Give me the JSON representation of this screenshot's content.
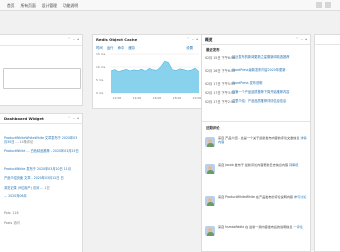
{
  "topbar": {
    "nav": [
      "首页",
      "所有页面",
      "设计管理",
      "功能说明"
    ]
  },
  "left_panel_top": {
    "ctrl": [
      "⌃",
      "⌄",
      "▴"
    ]
  },
  "dashboard_widget": {
    "title": "Dashboard Widget",
    "items": [
      {
        "text": "ProductWhiteWhiteWhite 文章发布于 2020年03月30日 …",
        "meta": "14条评论"
      },
      {
        "text": "ProductWhite … 白色精品推荐 - 2020年03月25日",
        "meta": ""
      },
      {
        "text": "ProductWhite 发布于 2020年03月20日 11月",
        "meta": ""
      },
      {
        "text": "产品介绍页面 文章 - 2020年03月12日 日",
        "meta": ""
      },
      {
        "text": "浏览记录 (9位用户) 访问 …",
        "meta": "1日"
      },
      {
        "text": "… 2020年06月",
        "meta": ""
      },
      {
        "text": "Pols: 116",
        "meta": ""
      },
      {
        "text": "Posts 访问",
        "meta": ""
      }
    ]
  },
  "chart_panel": {
    "title": "Redis Object Cache",
    "tabs": [
      "时间",
      "运行",
      "命中",
      "缓存"
    ],
    "corner_link": "设置"
  },
  "chart_data": {
    "type": "area",
    "title": "",
    "xlabel": "",
    "ylabel": "",
    "y_ticks": [
      "15 ms",
      "10 ms",
      "5 ms",
      "0 ms"
    ],
    "ylim": [
      0,
      15
    ],
    "x_ticks": [
      "12:00",
      "14:00",
      "16:00",
      "18:00",
      "20:00"
    ],
    "values": [
      8.5,
      9.0,
      8.2,
      8.7,
      9.1,
      8.5,
      8.9,
      8.6,
      9.2,
      8.4,
      9.5,
      8.9,
      8.8,
      10.1,
      12.2,
      11.8,
      9.0,
      8.6,
      9.3,
      9.0,
      8.5,
      8.8,
      9.6,
      8.2
    ],
    "color": "#61c3e8",
    "grid": true
  },
  "news_panel": {
    "title": "概览",
    "section_label": "最近发布",
    "rows": [
      {
        "date": "02月 15日 下午6:50",
        "title": "最近发布的新闻更新之星期新闻精选推荐"
      },
      {
        "date": "02月 16日 下午6:50",
        "title": "WordPress最新发布内容2020年更新"
      },
      {
        "date": "02月 17日 下午5:50",
        "title": "WordPress 发布说明"
      },
      {
        "date": "02月 17日 下午3:50",
        "title": "你第一个产品品质推荐下周开始推荐内容"
      },
      {
        "date": "02月 17日 下午2:50",
        "title": "这里介绍：产品品质推荐详情信息信息"
      }
    ],
    "comments_label": "近期评论",
    "comments": [
      {
        "text": "来自 产品介绍 - 这是一个关于最新发布内容的评论文章信息",
        "tag": "详情内容"
      },
      {
        "text": "来自 Jacob 发布于 最新评论内容更新日志信息内容",
        "tag": "待审核"
      },
      {
        "text": "来自 ProductWhiteWhite 在产品发布的评论说明内容",
        "tag": "参与讨论"
      },
      {
        "text": "来自 hsmaxfiddle 在 最新一篇内容发布后的说明信息",
        "tag": "一评论"
      }
    ]
  }
}
